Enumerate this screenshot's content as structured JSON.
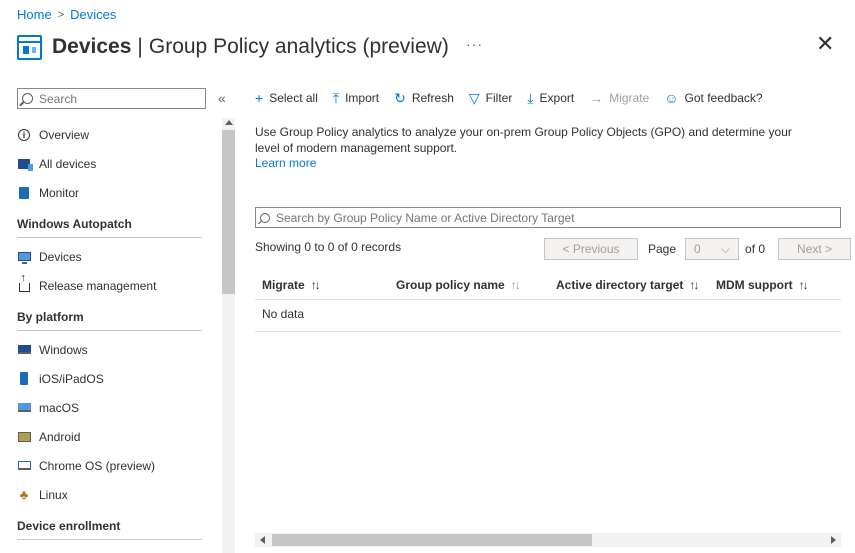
{
  "breadcrumb": {
    "home": "Home",
    "sep": ">",
    "devices": "Devices"
  },
  "header": {
    "title_main": "Devices",
    "title_sep": "|",
    "title_sub": "Group Policy analytics (preview)",
    "more": "···",
    "close": "✕"
  },
  "nav": {
    "search_placeholder": "Search",
    "collapse": "«",
    "items_top": [
      {
        "label": "Overview",
        "icon": "info-icon"
      },
      {
        "label": "All devices",
        "icon": "devices-icon"
      },
      {
        "label": "Monitor",
        "icon": "monitor-icon"
      }
    ],
    "section_autopatch": "Windows Autopatch",
    "items_autopatch": [
      {
        "label": "Devices",
        "icon": "pc-icon"
      },
      {
        "label": "Release management",
        "icon": "share-icon"
      }
    ],
    "section_platform": "By platform",
    "items_platform": [
      {
        "label": "Windows",
        "icon": "windows-icon"
      },
      {
        "label": "iOS/iPadOS",
        "icon": "ios-icon"
      },
      {
        "label": "macOS",
        "icon": "mac-icon"
      },
      {
        "label": "Android",
        "icon": "android-icon"
      },
      {
        "label": "Chrome OS (preview)",
        "icon": "chrome-icon"
      },
      {
        "label": "Linux",
        "icon": "linux-icon"
      }
    ],
    "section_enrollment": "Device enrollment"
  },
  "toolbar": {
    "select_all": "Select all",
    "import": "Import",
    "refresh": "Refresh",
    "filter": "Filter",
    "export": "Export",
    "migrate": "Migrate",
    "feedback": "Got feedback?"
  },
  "description": "Use Group Policy analytics to analyze your on-prem Group Policy Objects (GPO) and determine your level of modern management support.",
  "learn_more": "Learn more",
  "main_search_placeholder": "Search by Group Policy Name or Active Directory Target",
  "records": "Showing 0 to 0 of 0 records",
  "pager": {
    "previous": "< Previous",
    "page_label": "Page",
    "page_value": "0",
    "of": "of 0",
    "next": "Next >"
  },
  "table": {
    "columns": [
      "Migrate",
      "Group policy name",
      "Active directory target",
      "MDM support"
    ],
    "empty": "No data"
  },
  "colors": {
    "accent": "#0078d4",
    "text": "#323130",
    "disabled": "#a19f9d"
  }
}
